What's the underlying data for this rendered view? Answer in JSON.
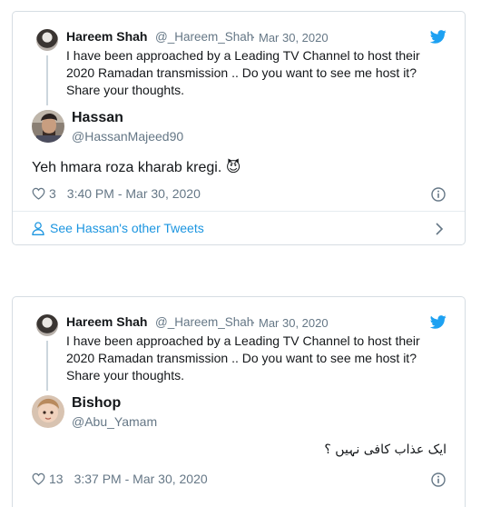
{
  "tweets": [
    {
      "parent": {
        "name": "Hareem Shah",
        "handle": "@_Hareem_Shah",
        "separator": "·",
        "date": "Mar 30, 2020",
        "text": "I have been approached by a Leading TV Channel to host their 2020 Ramadan transmission .. Do you want to see me host it? Share your thoughts."
      },
      "reply": {
        "name": "Hassan",
        "handle": "@HassanMajeed90",
        "text": "Yeh hmara roza kharab kregi. 😈",
        "likes": "3",
        "timestamp": "3:40 PM - Mar 30, 2020"
      },
      "other_tweets_label": "See Hassan's other Tweets"
    },
    {
      "parent": {
        "name": "Hareem Shah",
        "handle": "@_Hareem_Shah",
        "separator": "·",
        "date": "Mar 30, 2020",
        "text": "I have been approached by a Leading TV Channel to host their 2020 Ramadan transmission .. Do you want to see me host it? Share your thoughts."
      },
      "reply": {
        "name": "Bishop",
        "handle": "@Abu_Yamam",
        "text": "ایک عذاب کافی نہیں ؟",
        "likes": "13",
        "timestamp": "3:37 PM - Mar 30, 2020"
      }
    }
  ],
  "colors": {
    "twitter_blue": "#1da1f2",
    "link_blue": "#1b95e0",
    "muted": "#657786",
    "border": "#d6dde3"
  }
}
